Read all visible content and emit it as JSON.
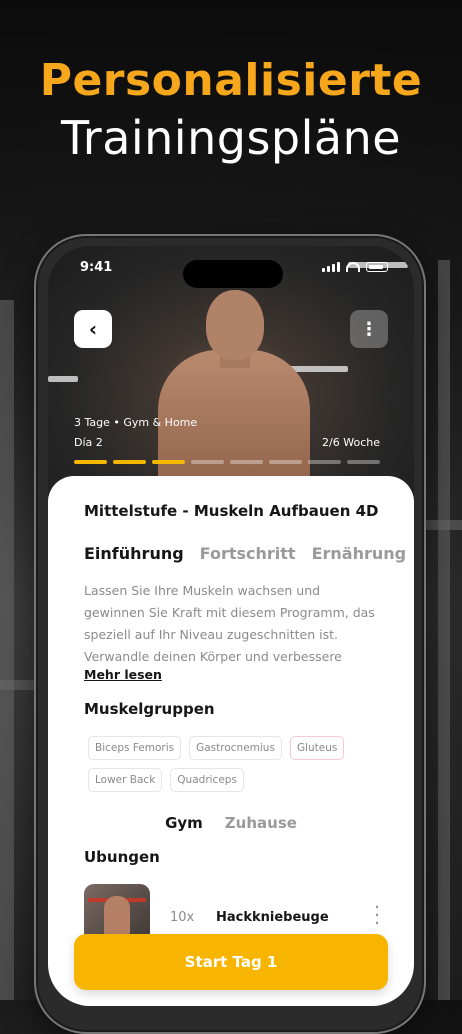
{
  "headline": {
    "line1": "Personalisierte",
    "line2": "Trainingspläne",
    "accent_color": "#F7A71C"
  },
  "status_bar": {
    "time": "9:41"
  },
  "hero": {
    "meta_line1": "3 Tage •  Gym & Home",
    "meta_line2": "Día 2",
    "week": "2/6 Woche",
    "progress_total_segments": 8,
    "progress_filled_segments": 3
  },
  "plan": {
    "title": "Mittelstufe - Muskeln Aufbauen 4D",
    "tabs": [
      {
        "label": "Einführung",
        "active": true
      },
      {
        "label": "Fortschritt",
        "active": false
      },
      {
        "label": "Ernährung",
        "active": false
      }
    ],
    "description": "Lassen Sie Ihre Muskeln wachsen und gewinnen Sie Kraft mit diesem Programm, das speziell auf Ihr Niveau zugeschnitten ist. Verwandle deinen Körper und verbessere",
    "more_label": "Mehr lesen",
    "muscles_title": "Muskelgruppen",
    "muscles": [
      "Biceps Femoris",
      "Gastrocnemius",
      "Gluteus",
      "Lower Back",
      "Quadriceps"
    ],
    "location_toggle": [
      {
        "label": "Gym",
        "active": true
      },
      {
        "label": "Zuhause",
        "active": false
      }
    ],
    "exercises_title": "Ubungen",
    "exercises": [
      {
        "reps": "10x",
        "name": "Hackkniebeuge"
      }
    ]
  },
  "cta": {
    "label": "Start Tag  1",
    "color": "#F7B500"
  }
}
